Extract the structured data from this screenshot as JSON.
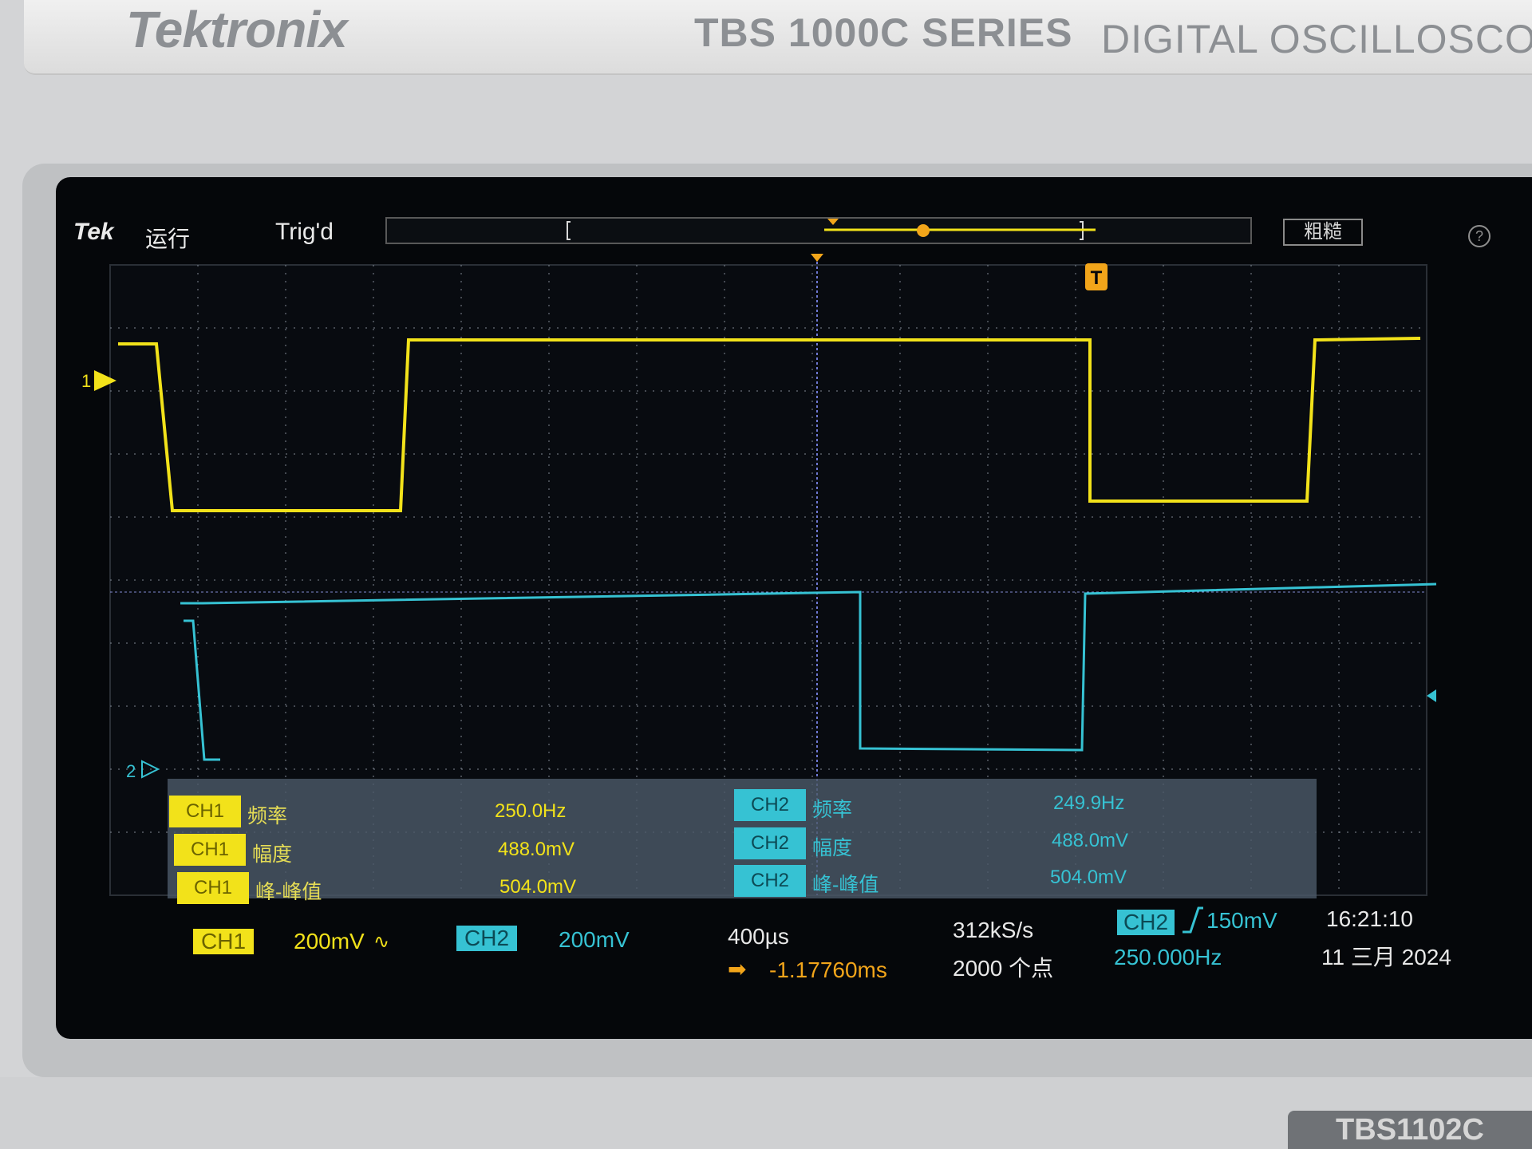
{
  "brand": "Tektronix",
  "series": "TBS 1000C SERIES",
  "product_type": "DIGITAL OSCILLOSCOPE",
  "model": "TBS1102C",
  "topbar": {
    "tek": "Tek",
    "run_status": "运行",
    "trigger_status": "Trig'd",
    "acquire_button": "粗糙",
    "help": "?"
  },
  "colors": {
    "ch1": "#f2e21a",
    "ch2": "#36c2d3",
    "grid": "#7f8792",
    "screen": "#05070a"
  },
  "markers": {
    "ch1": "1",
    "ch2": "2",
    "trigger": "T"
  },
  "measurements": {
    "ch1": [
      {
        "channel": "CH1",
        "name": "频率",
        "value": "250.0Hz"
      },
      {
        "channel": "CH1",
        "name": "幅度",
        "value": "488.0mV"
      },
      {
        "channel": "CH1",
        "name": "峰-峰值",
        "value": "504.0mV"
      }
    ],
    "ch2": [
      {
        "channel": "CH2",
        "name": "频率",
        "value": "249.9Hz"
      },
      {
        "channel": "CH2",
        "name": "幅度",
        "value": "488.0mV"
      },
      {
        "channel": "CH2",
        "name": "峰-峰值",
        "value": "504.0mV"
      }
    ]
  },
  "status": {
    "ch1_label": "CH1",
    "ch1_scale": "200mV",
    "ch1_coupling": "∿",
    "ch2_label": "CH2",
    "ch2_scale": "200mV",
    "timebase": "400µs",
    "delay_icon": "➡",
    "delay": "-1.17760ms",
    "sample_rate": "312kS/s",
    "record_length": "2000 个点",
    "trigger_source": "CH2",
    "trigger_slope": "rising-edge-icon",
    "trigger_level": "150mV",
    "trigger_freq": "250.000Hz",
    "time": "16:21:10",
    "date": "11 三月 2024"
  }
}
